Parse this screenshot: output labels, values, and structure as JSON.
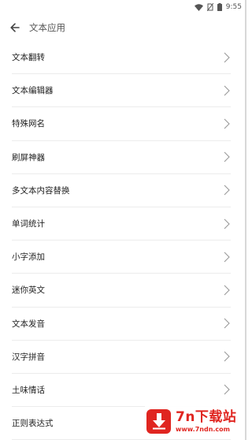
{
  "status_bar": {
    "time": "9:55"
  },
  "header": {
    "title": "文本应用"
  },
  "list": {
    "items": [
      {
        "label": "文本翻转"
      },
      {
        "label": "文本编辑器"
      },
      {
        "label": "特殊网名"
      },
      {
        "label": "刷屏神器"
      },
      {
        "label": "多文本内容替换"
      },
      {
        "label": "单词统计"
      },
      {
        "label": "小字添加"
      },
      {
        "label": "迷你英文"
      },
      {
        "label": "文本发音"
      },
      {
        "label": "汉字拼音"
      },
      {
        "label": "土味情话"
      },
      {
        "label": "正则表达式"
      }
    ]
  },
  "watermark": {
    "title": "7n下载站",
    "url": "www.7ndn.com"
  }
}
